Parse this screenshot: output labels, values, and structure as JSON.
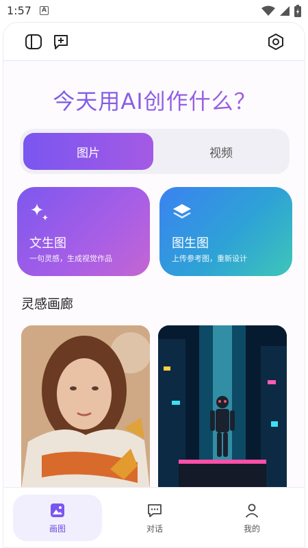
{
  "status": {
    "time": "1:57",
    "notification_letter": "A"
  },
  "topbar": {
    "left_icon_1": "sidebar-toggle-icon",
    "left_icon_2": "new-chat-icon",
    "right_icon": "settings-hex-icon"
  },
  "headline": "今天用AI创作什么？",
  "segment": {
    "active": "图片",
    "inactive": "视频"
  },
  "cards": [
    {
      "title": "文生图",
      "subtitle": "一句灵感，生成视觉作品",
      "icon": "sparkle-icon",
      "accent": "#8a5cf0"
    },
    {
      "title": "图生图",
      "subtitle": "上传参考图，重新设计",
      "icon": "layers-icon",
      "accent": "#2e9fdc"
    }
  ],
  "gallery": {
    "title": "灵感画廊",
    "items": [
      "portrait-woman-scarf-image",
      "cyberpunk-robot-image"
    ]
  },
  "bottom_nav": [
    {
      "label": "画图",
      "icon": "image-icon",
      "active": true
    },
    {
      "label": "对话",
      "icon": "chat-icon",
      "active": false
    },
    {
      "label": "我的",
      "icon": "user-icon",
      "active": false
    }
  ]
}
